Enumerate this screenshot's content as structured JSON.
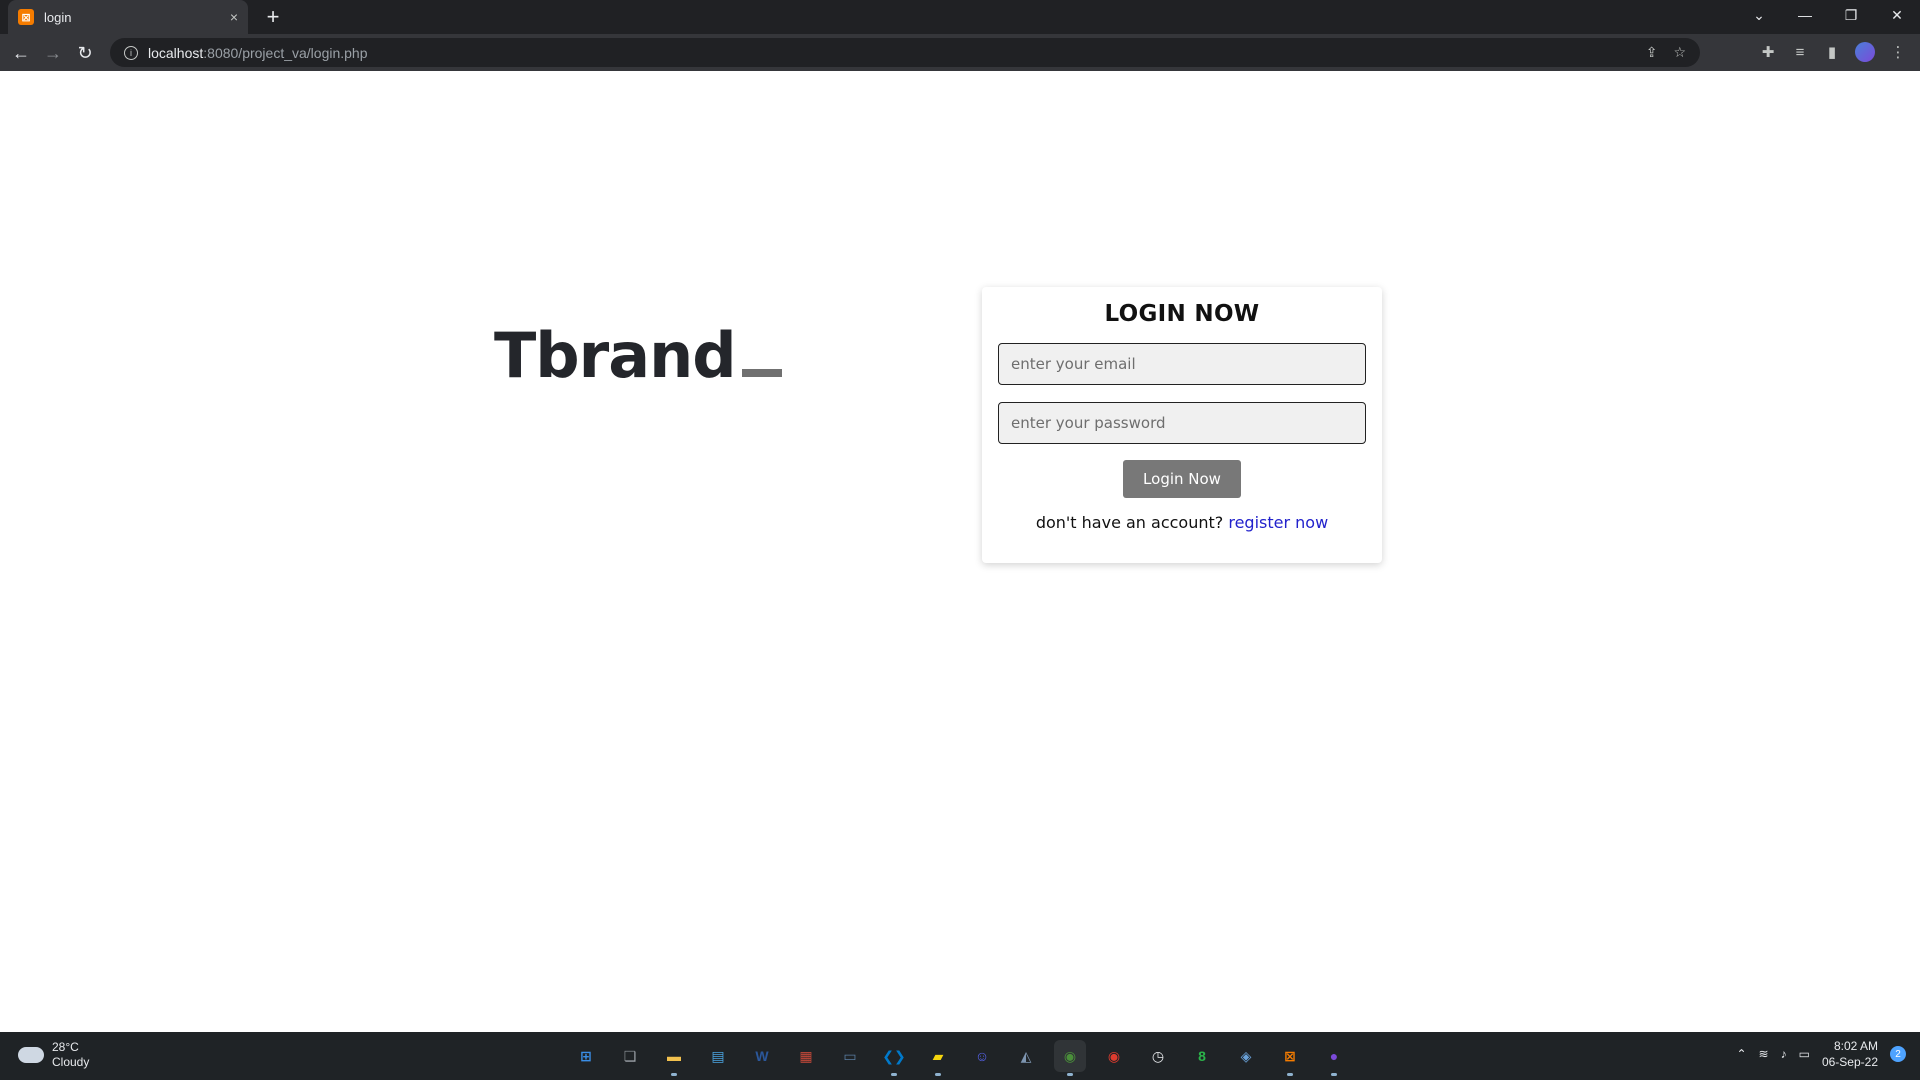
{
  "browser": {
    "tab_title": "login",
    "tab_close": "×",
    "new_tab": "+",
    "url_host": "localhost",
    "url_path": ":8080/project_va/login.php",
    "window_controls": [
      "⌄",
      "—",
      "❐",
      "✕"
    ]
  },
  "page": {
    "brand": "Tbrand",
    "login": {
      "heading": "LOGIN NOW",
      "email_placeholder": "enter your email",
      "password_placeholder": "enter your password",
      "submit_label": "Login Now",
      "register_prompt": "don't have an account?",
      "register_link": "register now"
    }
  },
  "taskbar": {
    "weather_temp": "28°C",
    "weather_desc": "Cloudy",
    "time": "8:02 AM",
    "date": "06-Sep-22",
    "notification_count": "2",
    "apps": [
      {
        "name": "start-icon",
        "color": "#3a8ee6"
      },
      {
        "name": "task-view-icon",
        "color": "#9aa0a6"
      },
      {
        "name": "file-explorer-icon",
        "color": "#f2c14e"
      },
      {
        "name": "notepad-icon",
        "color": "#4aa3df"
      },
      {
        "name": "word-icon",
        "color": "#2b579a"
      },
      {
        "name": "store-icon",
        "color": "#c94a3a"
      },
      {
        "name": "remote-desktop-icon",
        "color": "#5a7ea3"
      },
      {
        "name": "vscode-icon",
        "color": "#007acc"
      },
      {
        "name": "sticky-notes-icon",
        "color": "#f5d50d"
      },
      {
        "name": "discord-icon",
        "color": "#5865f2"
      },
      {
        "name": "photos-icon",
        "color": "#7d95b0"
      },
      {
        "name": "chrome-icon",
        "color": "#4a8f3a"
      },
      {
        "name": "chrome-profile-icon",
        "color": "#de3c2f"
      },
      {
        "name": "clock-icon",
        "color": "#e8eaed"
      },
      {
        "name": "counter-icon",
        "color": "#2bb34a"
      },
      {
        "name": "cube-icon",
        "color": "#6aa2d9"
      },
      {
        "name": "xampp-icon",
        "color": "#f57c00"
      },
      {
        "name": "github-icon",
        "color": "#7b4ad9"
      }
    ]
  },
  "colors": {
    "accent_link": "#2222cc",
    "button_bg": "#787878",
    "brand_text": "#24262b"
  }
}
